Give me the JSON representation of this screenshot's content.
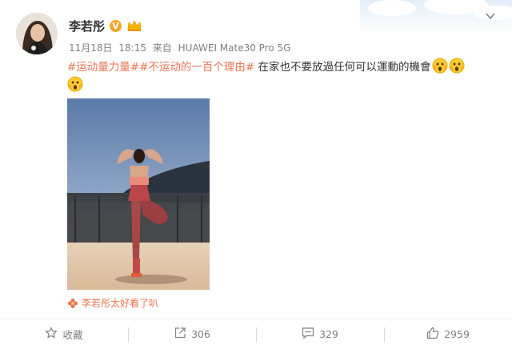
{
  "user": {
    "name": "李若彤",
    "verified_badge": "V",
    "avatar_icon": "avatar-photo"
  },
  "meta": {
    "date": "11月18日",
    "time": "18:15",
    "source_prefix": "来自",
    "device": "HUAWEI Mate30 Pro 5G"
  },
  "post": {
    "topic1": "#运动量力量#",
    "topic2": "#不运动的一百个理由#",
    "body": " 在家也不要放過任何可以運動的機會",
    "emoji_icon": "scream-face-emoji"
  },
  "photo": {
    "description_icon": "yoga-tree-pose-photo"
  },
  "caption": {
    "text": "李若彤太好看了叭",
    "icon": "flower-icon"
  },
  "actions": {
    "favorite_label": "收藏",
    "repost_count": "306",
    "comment_count": "329",
    "like_count": "2959"
  },
  "colors": {
    "accent": "#eb7350",
    "meta_gray": "#808080",
    "badge": "#f5a623"
  }
}
